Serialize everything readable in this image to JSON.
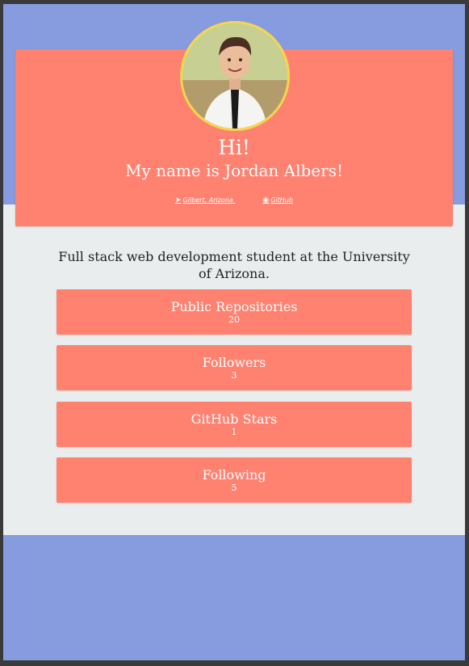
{
  "colors": {
    "page_background": "#eaeded",
    "accent_band": "#879bdf",
    "card": "#ff8170",
    "avatar_border": "#f6d64a",
    "text_dark": "#222222",
    "text_light": "#ffffff"
  },
  "profile": {
    "greeting": "Hi!",
    "intro": "My name is Jordan Albers!",
    "location": "Gilbert, Arizona",
    "location_icon": "location-arrow-icon",
    "github_label": "GitHub",
    "github_icon": "github-icon"
  },
  "bio": "Full stack web development student at the University of Arizona.",
  "stats": [
    {
      "label": "Public Repositories",
      "value": "20"
    },
    {
      "label": "Followers",
      "value": "3"
    },
    {
      "label": "GitHub Stars",
      "value": "1"
    },
    {
      "label": "Following",
      "value": "5"
    }
  ]
}
